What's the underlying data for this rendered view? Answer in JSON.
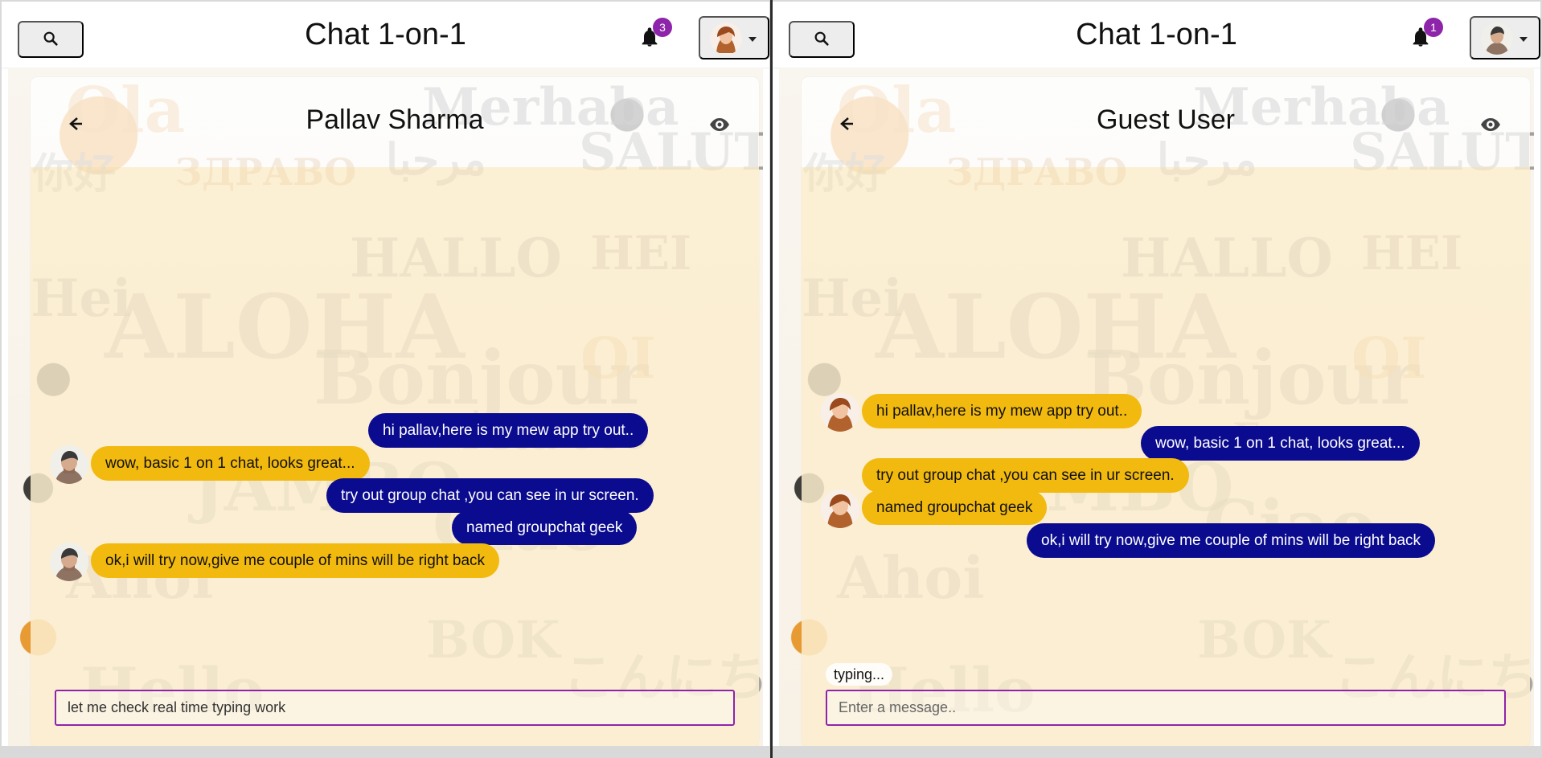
{
  "screens": [
    {
      "app_title": "Chat 1-on-1",
      "notification_count": "3",
      "chat_partner": "Pallav Sharma",
      "composer_value": "let me check real time typing work",
      "composer_placeholder": "Enter a message..",
      "typing_text": "",
      "profile_avatar": "woman-avatar-icon",
      "messages": [
        {
          "text": "hi pallav,here is my mew app try out..",
          "side": "outgoing"
        },
        {
          "text": "wow, basic 1 on 1 chat, looks great...",
          "side": "incoming",
          "avatar": "man-avatar-icon"
        },
        {
          "text": "try out group chat ,you can see in ur screen.",
          "side": "outgoing"
        },
        {
          "text": "named groupchat geek",
          "side": "outgoing"
        },
        {
          "text": "ok,i will try now,give me couple of mins will be right back",
          "side": "incoming",
          "avatar": "man-avatar-icon"
        }
      ]
    },
    {
      "app_title": "Chat 1-on-1",
      "notification_count": "1",
      "chat_partner": "Guest User",
      "composer_value": "",
      "composer_placeholder": "Enter a message..",
      "typing_text": "typing...",
      "profile_avatar": "man-avatar-icon",
      "messages": [
        {
          "text": "hi pallav,here is my mew app try out..",
          "side": "incoming",
          "avatar": "woman-avatar-icon"
        },
        {
          "text": "wow, basic 1 on 1 chat, looks great...",
          "side": "outgoing"
        },
        {
          "text": "try out group chat ,you can see in ur screen.",
          "side": "incoming"
        },
        {
          "text": "named groupchat geek",
          "side": "incoming",
          "avatar": "woman-avatar-icon"
        },
        {
          "text": "ok,i will try now,give me couple of mins will be right back",
          "side": "outgoing"
        }
      ]
    }
  ],
  "colors": {
    "outgoing_bubble": "#0b0b8f",
    "incoming_bubble": "#f2b90e",
    "badge": "#8e24aa",
    "composer_border": "#8e24aa"
  }
}
